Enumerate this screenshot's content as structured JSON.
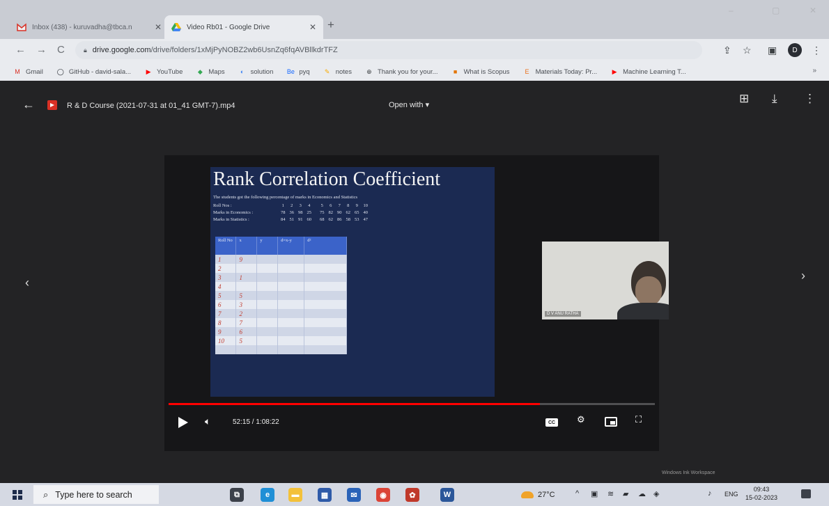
{
  "tabs": [
    {
      "title": "Inbox (438) - kuruvadha@tbca.n",
      "icon": "gmail-icon",
      "active": false
    },
    {
      "title": "Video Rb01 - Google Drive",
      "icon": "google-drive-icon",
      "active": true
    }
  ],
  "new_tab_label": "+",
  "window_controls": {
    "minimize": "–",
    "restore": "▢",
    "close": "✕"
  },
  "address_bar": {
    "host": "drive.google.com",
    "path": "/drive/folders/1xMjPyNOBZ2wb6UsnZq6fqAVBllkdrTFZ",
    "lock_icon": "lock-icon"
  },
  "nav": {
    "back": "←",
    "forward": "→",
    "reload": "C"
  },
  "toolbar_icons": {
    "share": "⇪",
    "bookmark_star": "☆",
    "extensions": "▣",
    "menu": "⋮"
  },
  "profile_initial": "D",
  "bookmarks": [
    {
      "label": "Gmail",
      "icon": "gmail-icon",
      "color": "#d93025",
      "glyph": "M"
    },
    {
      "label": "GitHub - david-sala...",
      "icon": "github-icon",
      "color": "#24292e",
      "glyph": "◯"
    },
    {
      "label": "YouTube",
      "icon": "youtube-icon",
      "color": "#ff0000",
      "glyph": "▶"
    },
    {
      "label": "Maps",
      "icon": "maps-icon",
      "color": "#34a853",
      "glyph": "◆"
    },
    {
      "label": "solution",
      "icon": "solution-icon",
      "color": "#4285f4",
      "glyph": "◐"
    },
    {
      "label": "pyq",
      "icon": "behance-icon",
      "color": "#1769ff",
      "glyph": "Be"
    },
    {
      "label": "notes",
      "icon": "notes-icon",
      "color": "#f9ab00",
      "glyph": "✎"
    },
    {
      "label": "Thank you for your...",
      "icon": "globe-icon",
      "color": "#3c4043",
      "glyph": "⊕"
    },
    {
      "label": "What is Scopus",
      "icon": "scopus-icon",
      "color": "#e37400",
      "glyph": "■"
    },
    {
      "label": "Materials Today: Pr...",
      "icon": "elsevier-icon",
      "color": "#e9711c",
      "glyph": "E"
    },
    {
      "label": "Machine Learning T...",
      "icon": "youtube-icon",
      "color": "#ff0000",
      "glyph": "▶"
    }
  ],
  "bookmarks_more": "»",
  "viewer": {
    "file_name": "R & D Course (2021-07-31 at 01_41 GMT-7).mp4",
    "open_with": "Open with ▾",
    "top_icons": {
      "add_shortcut": "⊞",
      "download": "⤓",
      "more": "⋮"
    },
    "prev": "‹",
    "next": "›"
  },
  "slide": {
    "title": "Rank Correlation Coefficient",
    "description": "The students got the following percentage of marks in Economics and Statistics",
    "rows": [
      {
        "label": "Roll Nos :",
        "values": [
          "1",
          "2",
          "3",
          "4",
          "5",
          "6",
          "7",
          "8",
          "9",
          "10"
        ]
      },
      {
        "label": "Marks in Economics :",
        "values": [
          "78",
          "36",
          "98",
          "25",
          "75",
          "82",
          "90",
          "62",
          "65",
          "40"
        ]
      },
      {
        "label": "Marks in Statistics :",
        "values": [
          "84",
          "51",
          "91",
          "60",
          "68",
          "62",
          "86",
          "58",
          "53",
          "47"
        ]
      }
    ],
    "table_headers": [
      "Roll No",
      "x",
      "y",
      "d=x-y",
      "d²"
    ],
    "table_rows": [
      [
        "1",
        "9",
        "",
        "",
        ""
      ],
      [
        "2",
        "",
        "",
        "",
        ""
      ],
      [
        "3",
        "1",
        "",
        "",
        ""
      ],
      [
        "4",
        "",
        "",
        "",
        ""
      ],
      [
        "5",
        "5",
        "",
        "",
        ""
      ],
      [
        "6",
        "3",
        "",
        "",
        ""
      ],
      [
        "7",
        "2",
        "",
        "",
        ""
      ],
      [
        "8",
        "7",
        "",
        "",
        ""
      ],
      [
        "9",
        "6",
        "",
        "",
        ""
      ],
      [
        "10",
        "5",
        "",
        "",
        ""
      ],
      [
        "",
        "",
        "",
        "",
        ""
      ]
    ]
  },
  "webcam_label": "D V ANU RATHA",
  "player": {
    "time": "52:15 / 1:08:22",
    "progress_fraction": 0.764,
    "icons": {
      "cc": "CC",
      "settings": "⚙",
      "fullscreen": "⛶"
    }
  },
  "watermark": "Windows Ink Workspace",
  "taskbar": {
    "search_placeholder": "Type here to search",
    "apps": [
      {
        "name": "task-view-icon",
        "color": "#3c414a",
        "glyph": "⧉"
      },
      {
        "name": "edge-icon",
        "color": "#1f8fd6",
        "glyph": "e"
      },
      {
        "name": "file-explorer-icon",
        "color": "#f3c13a",
        "glyph": "▬"
      },
      {
        "name": "store-icon",
        "color": "#2e5aa8",
        "glyph": "▦"
      },
      {
        "name": "mail-icon",
        "color": "#2a63b8",
        "glyph": "✉"
      },
      {
        "name": "chrome-icon",
        "color": "#db4437",
        "glyph": "◉"
      },
      {
        "name": "paint-icon",
        "color": "#c0392b",
        "glyph": "✿"
      },
      {
        "name": "word-icon",
        "color": "#2b579a",
        "glyph": "W"
      }
    ],
    "weather": "27°C",
    "tray_icons": [
      {
        "name": "chevron-up-icon",
        "glyph": "^"
      },
      {
        "name": "tray-app-icon",
        "glyph": "▣"
      },
      {
        "name": "network-icon",
        "glyph": "≋"
      },
      {
        "name": "meet-icon",
        "glyph": "▰"
      },
      {
        "name": "onedrive-icon",
        "glyph": "☁"
      },
      {
        "name": "dropbox-icon",
        "glyph": "◈"
      },
      {
        "name": "volume-icon",
        "glyph": "♪"
      }
    ],
    "language": "ENG",
    "time": "09:43",
    "date": "15-02-2023"
  }
}
